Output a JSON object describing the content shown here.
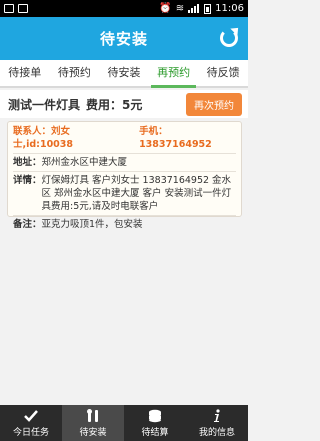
{
  "status_bar": {
    "time": "11:06"
  },
  "header": {
    "title": "待安装"
  },
  "tabs": [
    {
      "label": "待接单"
    },
    {
      "label": "待预约"
    },
    {
      "label": "待安装"
    },
    {
      "label": "再预约"
    },
    {
      "label": "待反馈"
    }
  ],
  "item": {
    "title": "测试一件灯具",
    "fee": "费用：5元",
    "reorder_button": "再次预约",
    "contact": "联系人：刘女士,id:10038",
    "phone": "手机：13837164952",
    "address_label": "地址：",
    "address_value": "郑州金水区中建大厦",
    "details_label": "详情：",
    "details_value": "灯保姆灯具 客户刘女士 13837164952 金水区 郑州金水区中建大厦 客户 安装测试一件灯具费用:5元,请及时电联客户",
    "remark_label": "备注：",
    "remark_value": "亚克力吸顶1件，包安装"
  },
  "bottom_nav": [
    {
      "label": "今日任务",
      "icon": "check-icon"
    },
    {
      "label": "待安装",
      "icon": "tools-icon"
    },
    {
      "label": "待结算",
      "icon": "database-icon"
    },
    {
      "label": "我的信息",
      "icon": "info-icon"
    }
  ],
  "colors": {
    "primary": "#1fa6e0",
    "accent": "#f2873a",
    "active_tab": "#2a9a2a"
  }
}
